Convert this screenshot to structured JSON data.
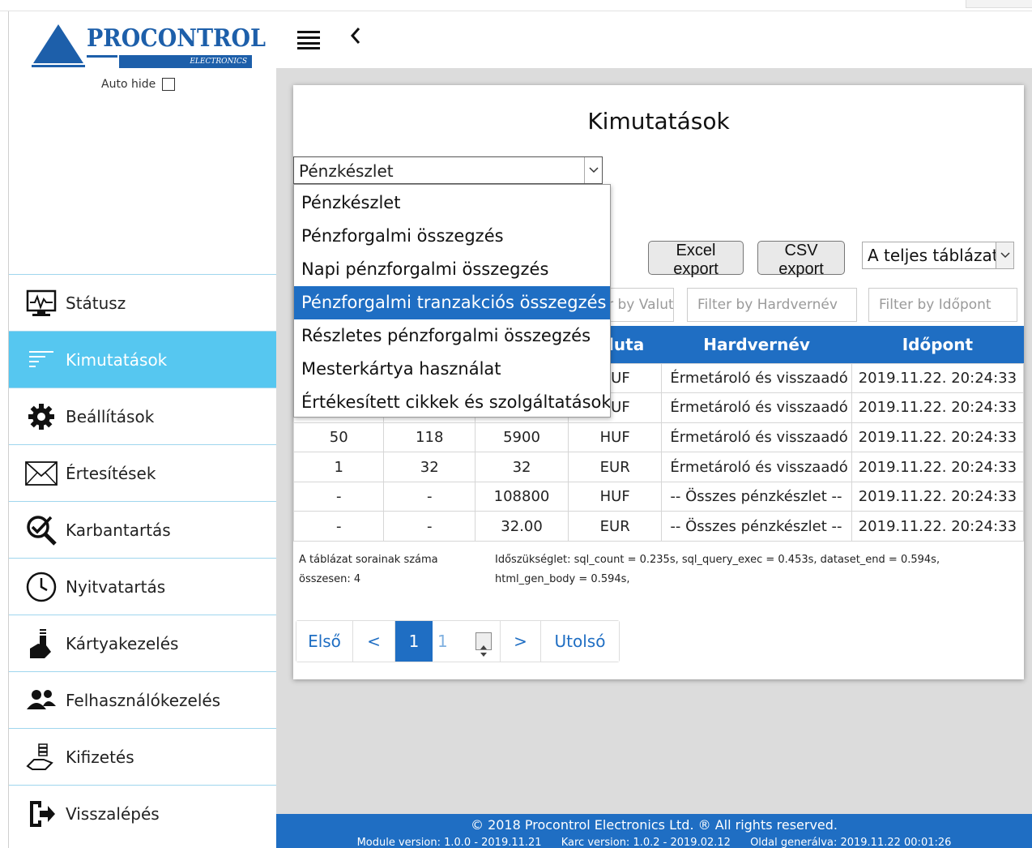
{
  "brand": {
    "name": "PROCONTROL",
    "sub": "ELECTRONICS"
  },
  "sidebar": {
    "autohide_label": "Auto hide",
    "items": [
      {
        "label": "Státusz",
        "icon": "monitor-pulse-icon"
      },
      {
        "label": "Kimutatások",
        "icon": "report-lines-icon"
      },
      {
        "label": "Beállítások",
        "icon": "gear-icon"
      },
      {
        "label": "Értesítések",
        "icon": "envelope-icon"
      },
      {
        "label": "Karbantartás",
        "icon": "magnifier-check-icon"
      },
      {
        "label": "Nyitvatartás",
        "icon": "clock-icon"
      },
      {
        "label": "Kártyakezelés",
        "icon": "hand-card-icon"
      },
      {
        "label": "Felhasználókezelés",
        "icon": "users-icon"
      },
      {
        "label": "Kifizetés",
        "icon": "hand-coins-icon"
      },
      {
        "label": "Visszalépés",
        "icon": "exit-door-icon"
      }
    ],
    "active_index": 1
  },
  "page": {
    "title": "Kimutatások"
  },
  "report_select": {
    "value": "Pénzkészlet",
    "options": [
      "Pénzkészlet",
      "Pénzforgalmi összegzés",
      "Napi pénzforgalmi összegzés",
      "Pénzforgalmi tranzakciós összegzés",
      "Részletes pénzforgalmi összegzés",
      "Mesterkártya használat",
      "Értékesített cikkek és szolgáltatások"
    ],
    "highlighted_index": 3
  },
  "toolbar": {
    "excel_label": "Excel export",
    "csv_label": "CSV export",
    "scope_value": "A teljes táblázat"
  },
  "filters": {
    "valuta_placeholder": "Filter by Valuta",
    "hardware_placeholder": "Filter by Hardvernév",
    "time_placeholder": "Filter by Időpont"
  },
  "table": {
    "headers": [
      "",
      "",
      "",
      "Valuta",
      "Hardvernév",
      "Időpont"
    ],
    "rows": [
      [
        "",
        "",
        "",
        "HUF",
        "Érmetároló és visszaadó",
        "2019.11.22. 20:24:33"
      ],
      [
        "",
        "",
        "",
        "HUF",
        "Érmetároló és visszaadó",
        "2019.11.22. 20:24:33"
      ],
      [
        "50",
        "118",
        "5900",
        "HUF",
        "Érmetároló és visszaadó",
        "2019.11.22. 20:24:33"
      ],
      [
        "1",
        "32",
        "32",
        "EUR",
        "Érmetároló és visszaadó",
        "2019.11.22. 20:24:33"
      ],
      [
        "-",
        "-",
        "108800",
        "HUF",
        "-- Összes pénzkészlet --",
        "2019.11.22. 20:24:33"
      ],
      [
        "-",
        "-",
        "32.00",
        "EUR",
        "-- Összes pénzkészlet --",
        "2019.11.22. 20:24:33"
      ]
    ]
  },
  "summary": {
    "row_count_line1": "A táblázat sorainak száma",
    "row_count_line2": "összesen: 4",
    "timing_line1": "Időszükséglet: sql_count = 0.235s, sql_query_exec = 0.453s, dataset_end = 0.594s,",
    "timing_line2": "html_gen_body = 0.594s,"
  },
  "pager": {
    "first": "Első",
    "prev": "<",
    "current": "1",
    "input_value": "1",
    "next": ">",
    "last": "Utolsó"
  },
  "footer": {
    "copyright": "© 2018 Procontrol Electronics Ltd. ® All rights reserved.",
    "module_version": "Module version: 1.0.0 - 2019.11.21",
    "karc_version": "Karc version: 1.0.2 - 2019.02.12",
    "generated": "Oldal generálva: 2019.11.22 00:01:26"
  },
  "colors": {
    "brand_blue": "#1d5faa",
    "active_menu": "#56c7f0",
    "primary": "#1f6ec3"
  }
}
